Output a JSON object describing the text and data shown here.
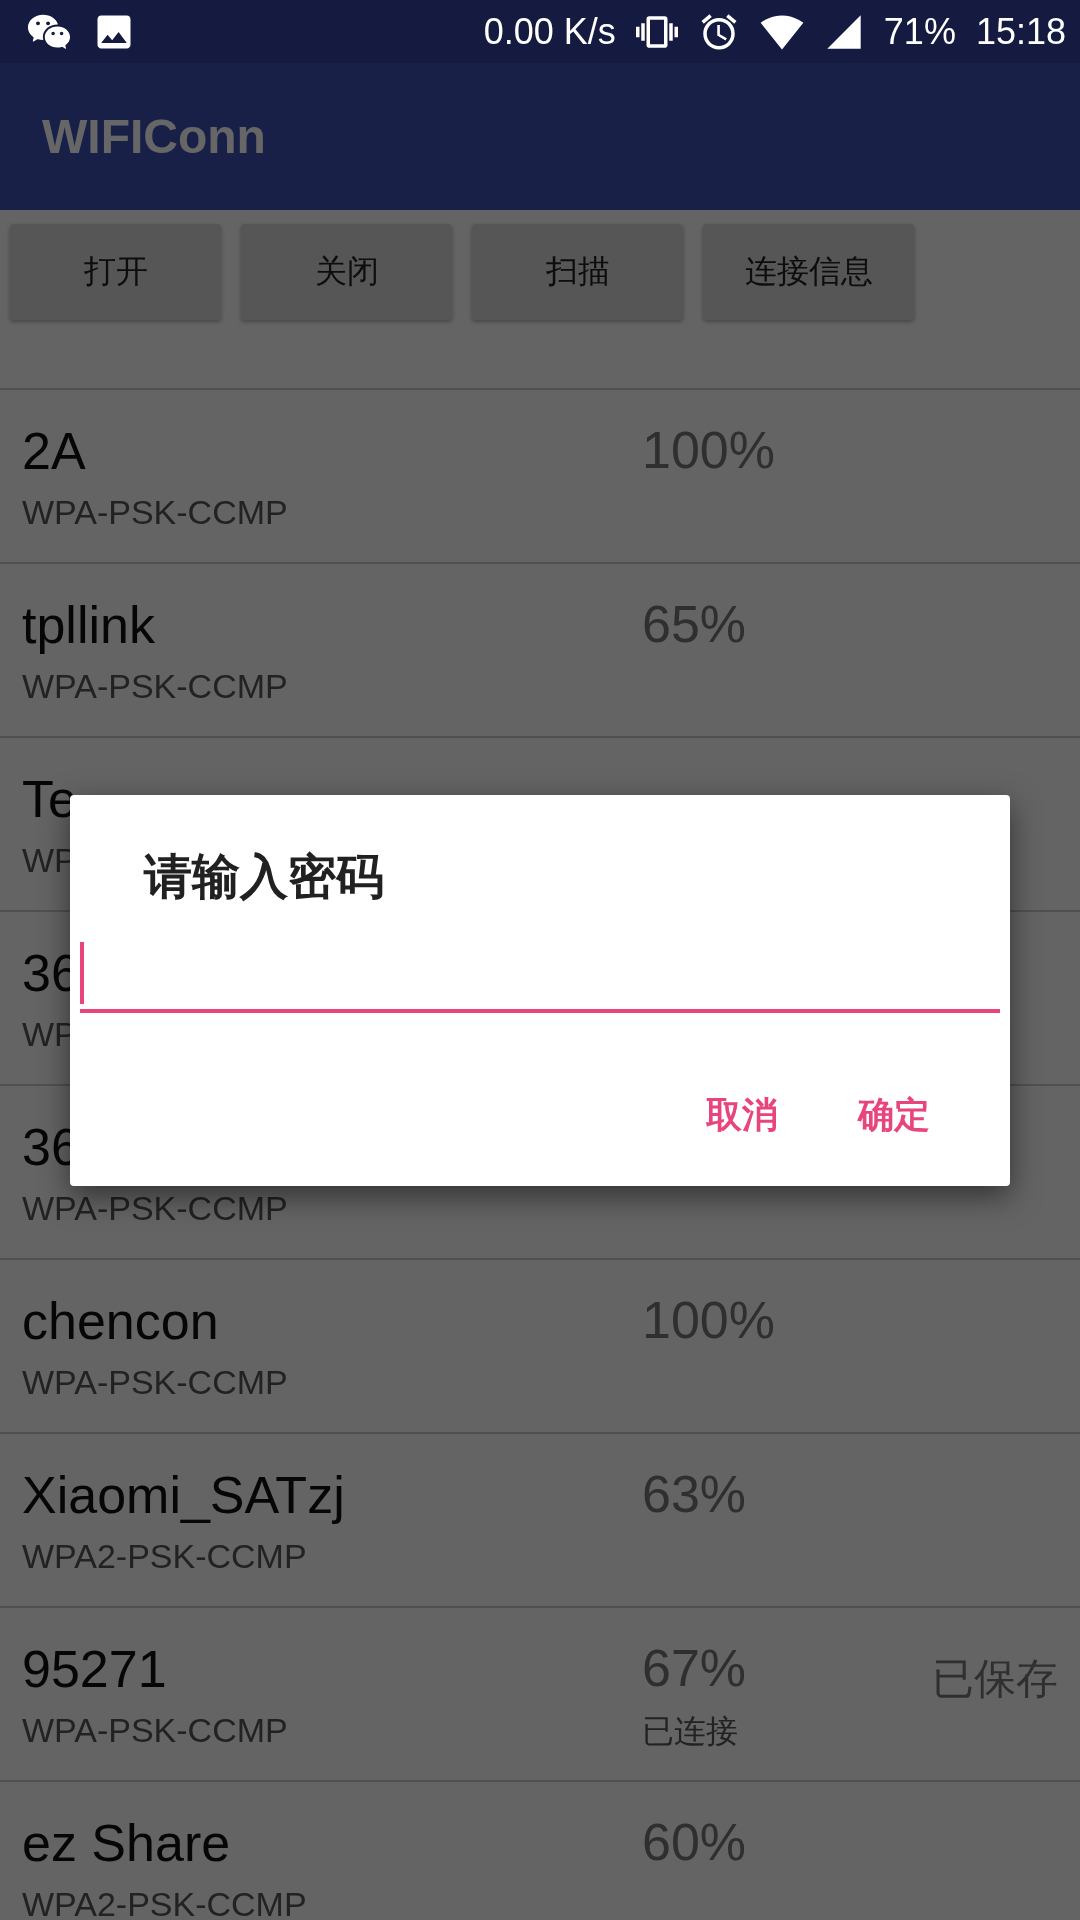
{
  "status_bar": {
    "net_speed": "0.00 K/s",
    "battery": "71%",
    "time": "15:18"
  },
  "app_bar": {
    "title": "WIFIConn"
  },
  "buttons": [
    "打开",
    "关闭",
    "扫描",
    "连接信息"
  ],
  "networks": [
    {
      "name": "2A",
      "security": "WPA-PSK-CCMP",
      "signal": "100%"
    },
    {
      "name": "tpllink",
      "security": "WPA-PSK-CCMP",
      "signal": "65%"
    },
    {
      "name": "Te",
      "security": "WP"
    },
    {
      "name": "36",
      "security": "WP"
    },
    {
      "name": "36",
      "security": "WPA-PSK-CCMP"
    },
    {
      "name": "chencon",
      "security": "WPA-PSK-CCMP",
      "signal": "100%"
    },
    {
      "name": "Xiaomi_SATzj",
      "security": "WPA2-PSK-CCMP",
      "signal": "63%"
    },
    {
      "name": "95271",
      "security": "WPA-PSK-CCMP",
      "signal": "67%",
      "status": "已连接",
      "saved": "已保存"
    },
    {
      "name": "ez Share",
      "security": "WPA2-PSK-CCMP",
      "signal": "60%"
    }
  ],
  "dialog": {
    "title": "请输入密码",
    "password_field": {
      "focused": true
    },
    "buttons": [
      "取消",
      "确定"
    ]
  }
}
